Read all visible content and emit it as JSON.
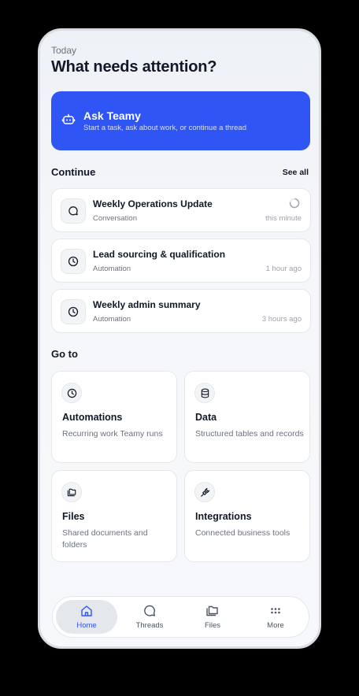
{
  "header": {
    "eyebrow": "Today",
    "title": "What needs attention?"
  },
  "ask": {
    "title": "Ask Teamy",
    "subtitle": "Start a task, ask about work, or continue a thread",
    "icon": "bot-icon",
    "color": "#2f55f4"
  },
  "continue": {
    "heading": "Continue",
    "see_all": "See all",
    "items": [
      {
        "title": "Weekly Operations Update",
        "type": "Conversation",
        "time": "this minute",
        "icon": "chat-icon",
        "loading": true
      },
      {
        "title": "Lead sourcing & qualification",
        "type": "Automation",
        "time": "1 hour ago",
        "icon": "clock-icon"
      },
      {
        "title": "Weekly admin summary",
        "type": "Automation",
        "time": "3 hours ago",
        "icon": "clock-icon"
      }
    ]
  },
  "goto": {
    "heading": "Go to",
    "tiles": [
      {
        "title": "Automations",
        "desc": "Recurring work Teamy runs",
        "icon": "clock-icon"
      },
      {
        "title": "Data",
        "desc": "Structured tables and records",
        "icon": "database-icon"
      },
      {
        "title": "Files",
        "desc": "Shared documents and folders",
        "icon": "folders-icon"
      },
      {
        "title": "Integrations",
        "desc": "Connected business tools",
        "icon": "plug-icon"
      }
    ]
  },
  "tabs": [
    {
      "label": "Home",
      "icon": "home-icon",
      "active": true
    },
    {
      "label": "Threads",
      "icon": "chat-icon"
    },
    {
      "label": "Files",
      "icon": "folders-icon"
    },
    {
      "label": "More",
      "icon": "dots-icon"
    }
  ]
}
